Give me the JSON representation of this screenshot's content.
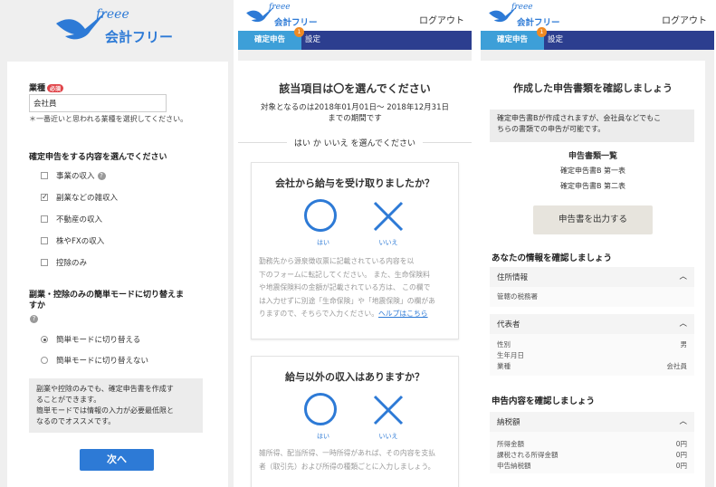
{
  "brand": {
    "wordmark": "freee",
    "product": "会計フリー",
    "colors": {
      "blue": "#2d7ad6",
      "navy": "#2c3e8f",
      "light_blue": "#3d9fd8",
      "orange": "#f08a22",
      "red": "#e0454a"
    }
  },
  "panel1": {
    "industry_label": "業種",
    "required_badge": "必須",
    "industry_value": "会社員",
    "industry_note": "＊一番近いと思われる業種を選択してください。",
    "content_title": "確定申告をする内容を選んでください",
    "checkboxes": [
      {
        "label": "事業の収入",
        "checked": false,
        "help": true
      },
      {
        "label": "副業などの雑収入",
        "checked": true,
        "help": false
      },
      {
        "label": "不動産の収入",
        "checked": false,
        "help": false
      },
      {
        "label": "株やFXの収入",
        "checked": false,
        "help": false
      },
      {
        "label": "控除のみ",
        "checked": false,
        "help": false
      }
    ],
    "mode_title_1": "副業・控除のみの簡単モードに切り替えま",
    "mode_title_2": "すか",
    "radios": [
      {
        "label": "簡単モードに切り替える",
        "selected": true
      },
      {
        "label": "簡単モードに切り替えない",
        "selected": false
      }
    ],
    "info_lines": [
      "副業や控除のみでも、確定申告書を作成す",
      "ることができます。",
      "簡単モードでは情報の入力が必要最低限と",
      "なるのでオススメです。"
    ],
    "next_button": "次へ"
  },
  "header": {
    "logout": "ログアウト",
    "tab_tax": "確定申告",
    "tab_settings": "設定",
    "notif_count": "1"
  },
  "panel2": {
    "title": "該当項目は〇を選んでください",
    "period_1": "対象となるのは2018年01月01日〜 2018年12月31日",
    "period_2": "までの期間です",
    "yes_no_heading": "はい か いいえ を選んでください",
    "q1": "会社から給与を受け取りましたか？",
    "yes": "はい",
    "no": "いいえ",
    "q1_desc": [
      "勤務先から源泉徴収票に記載されている内容を以",
      "下のフォームに転記してください。 また、生命保険料",
      "や地震保険料の金額が記載されている方は、 この欄で",
      "は入力せずに別途「生命保険」や「地震保険」の欄があ",
      "りますので、そちらで入力ください。"
    ],
    "help_link": "ヘルプはこちら",
    "q2": "給与以外の収入はありますか？",
    "q2_desc": [
      "雑所得、配当所得、一時所得があれば、その内容を支払",
      "者（取引先）および所得の種類ごとに入力しましょう。"
    ]
  },
  "panel3": {
    "title": "作成した申告書類を確認しましょう",
    "notice_1": "確定申告書Bが作成されますが、会社員などでもこ",
    "notice_2": "ちらの書類での申告が可能です。",
    "docs_title": "申告書類一覧",
    "doc_1": "確定申告書B 第一表",
    "doc_2": "確定申告書B 第二表",
    "output_button": "申告書を出力する",
    "your_info": "あなたの情報を確認しましょう",
    "address_label": "住所情報",
    "tax_office": "管轄の税務署",
    "rep_label": "代表者",
    "rep_rows": [
      {
        "k": "性別",
        "v": "男"
      },
      {
        "k": "生年月日",
        "v": ""
      },
      {
        "k": "業種",
        "v": "会社員"
      }
    ],
    "confirm_content": "申告内容を確認しましょう",
    "tax_label": "納税額",
    "tax_rows": [
      {
        "k": "所得金額",
        "v": "0円"
      },
      {
        "k": "課税される所得金額",
        "v": "0円"
      },
      {
        "k": "申告納税額",
        "v": "0円"
      }
    ]
  }
}
